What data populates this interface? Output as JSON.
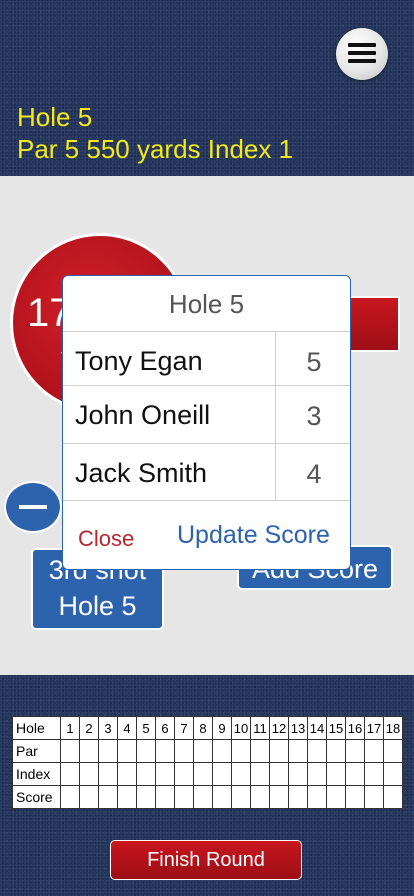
{
  "header": {
    "hole_title": "Hole 5",
    "hole_info": "Par 5  550 yards  Index 1",
    "menu_icon": "hamburger-menu-icon"
  },
  "main": {
    "circle_big_text": "17",
    "circle_small_text": "t",
    "shot_button_line1": "3rd shot",
    "shot_button_line2": "Hole 5",
    "add_score_label": "Add Score"
  },
  "dialog": {
    "title": "Hole 5",
    "players": [
      {
        "name": "Tony Egan",
        "score": "5"
      },
      {
        "name": "John Oneill",
        "score": "3"
      },
      {
        "name": "Jack Smith",
        "score": "4"
      }
    ],
    "close_label": "Close",
    "update_label": "Update Score"
  },
  "scorecard": {
    "header_label": "Hole",
    "holes": [
      "1",
      "2",
      "3",
      "4",
      "5",
      "6",
      "7",
      "8",
      "9",
      "10",
      "11",
      "12",
      "13",
      "14",
      "15",
      "16",
      "17",
      "18"
    ],
    "row_labels": [
      "Par",
      "Index",
      "Score"
    ]
  },
  "footer": {
    "finish_label": "Finish Round"
  },
  "colors": {
    "accent_yellow": "#f3e91b",
    "button_blue": "#2d62ad",
    "button_red": "#b0121b"
  }
}
